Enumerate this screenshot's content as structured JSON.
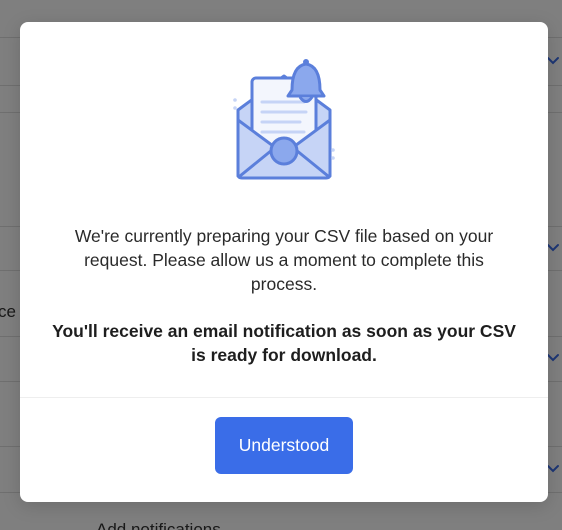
{
  "background": {
    "edge_text": "ce",
    "bottom_text": "Add notifications",
    "accordion_chevron_icon": "chevron-down-icon"
  },
  "modal": {
    "illustration_icon": "envelope-bell-icon",
    "message": "We're currently preparing your CSV file based on your request. Please allow us a moment to complete this process.",
    "emphasis": "You'll receive an email notification as soon as your CSV is ready for download.",
    "button_label": "Understood"
  },
  "colors": {
    "accent": "#3a6de8",
    "illustration_fill": "#c6d4f6",
    "illustration_stroke": "#5b7fdb",
    "chevron": "#3a6de8"
  }
}
